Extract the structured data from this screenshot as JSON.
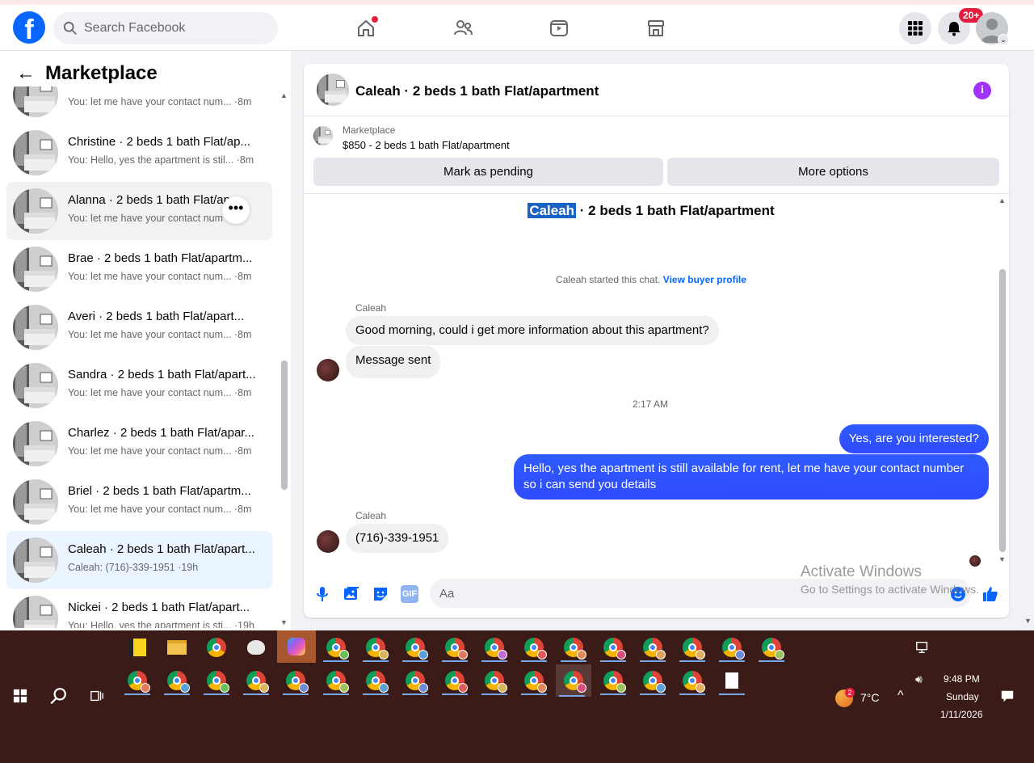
{
  "topbar": {
    "logo": "f",
    "search_placeholder": "Search Facebook",
    "notification_badge": "20+"
  },
  "sidebar": {
    "title": "Marketplace",
    "conversations": [
      {
        "title": "",
        "subtitle": "You: let me have your contact num... ·8m"
      },
      {
        "title": "Christine · 2 beds 1 bath Flat/ap...",
        "subtitle": "You: Hello, yes the apartment is stil... ·8m"
      },
      {
        "title": "Alanna · 2 beds 1 bath Flat/ap...",
        "subtitle": "You: let me have your contact num ·8m"
      },
      {
        "title": "Brae · 2 beds 1 bath Flat/apartm...",
        "subtitle": "You: let me have your contact num... ·8m"
      },
      {
        "title": "Averi · 2 beds 1 bath Flat/apart...",
        "subtitle": "You: let me have your contact num... ·8m"
      },
      {
        "title": "Sandra · 2 beds 1 bath Flat/apart...",
        "subtitle": "You: let me have your contact num... ·8m"
      },
      {
        "title": "Charlez · 2 beds 1 bath Flat/apar...",
        "subtitle": "You: let me have your contact num... ·8m"
      },
      {
        "title": "Briel · 2 beds 1 bath Flat/apartm...",
        "subtitle": "You: let me have your contact num... ·8m"
      },
      {
        "title": "Caleah · 2 beds 1 bath Flat/apart...",
        "subtitle": "Caleah: (716)-339-1951 ·19h"
      },
      {
        "title": "Nickei · 2 beds 1 bath Flat/apart...",
        "subtitle": "You: Hello, yes the apartment is sti... ·19h"
      }
    ]
  },
  "chat": {
    "header_title": "Caleah · 2 beds 1 bath Flat/apartment",
    "listing_source": "Marketplace",
    "listing_price": "$850 - 2 beds 1 bath Flat/apartment",
    "mark_pending": "Mark as pending",
    "more_options": "More options",
    "top_name_highlight": "Caleah",
    "top_title_rest": "· 2 beds 1 bath Flat/apartment",
    "started_text": "Caleah started this chat.",
    "view_buyer": "View buyer profile",
    "sender_name": "Caleah",
    "msg1": "Good morning, could i get more information about this apartment?",
    "msg2": "Message sent",
    "time_sep": "2:17 AM",
    "out1": "Yes, are you interested?",
    "out2": "Hello, yes the apartment is still available for rent, let me have your contact number so i can send you details",
    "msg3": "(716)-339-1951",
    "input_placeholder": "Aa",
    "gif_label": "GIF"
  },
  "watermark": {
    "line1": "Activate Windows",
    "line2": "Go to Settings to activate Windows."
  },
  "taskbar": {
    "temperature": "7°C",
    "weather_badge": "2",
    "time": "9:48 PM",
    "day": "Sunday",
    "date": "1/11/2026"
  },
  "colors": {
    "fb_blue": "#0866ff",
    "outgoing_bubble": "#2f4bff",
    "info_purple": "#a033ff",
    "taskbar": "#3b1b18"
  }
}
